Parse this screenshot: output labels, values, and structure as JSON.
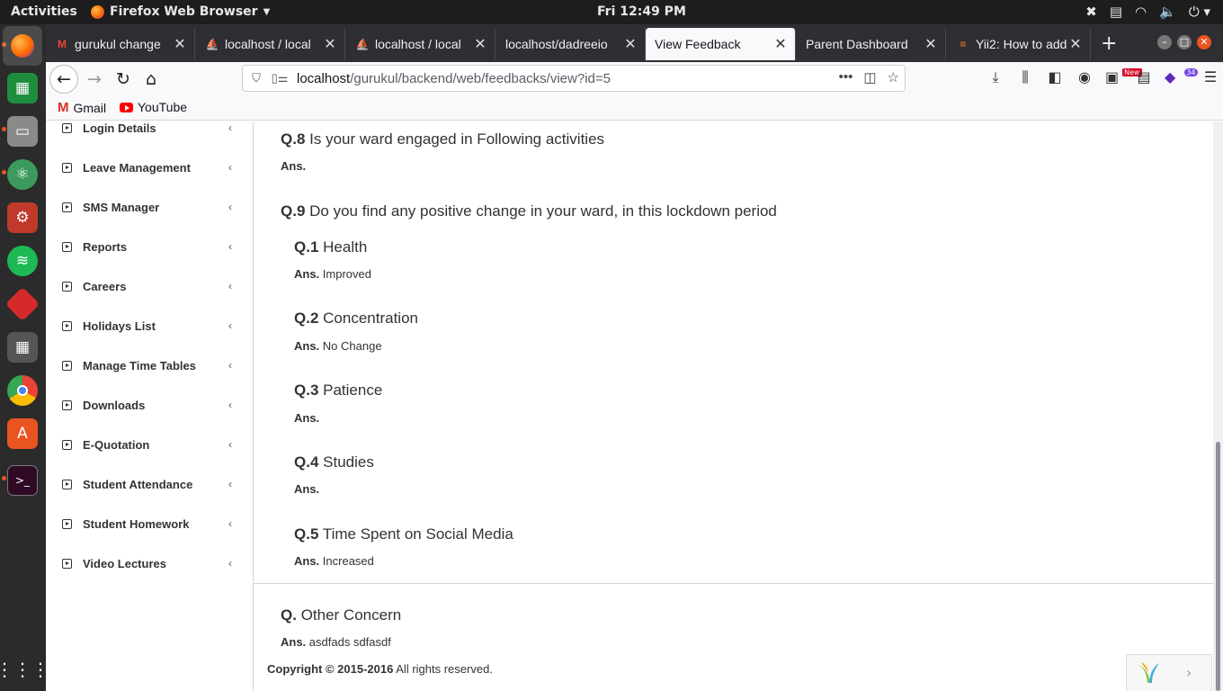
{
  "system": {
    "activities": "Activities",
    "app_name": "Firefox Web Browser",
    "clock": "Fri 12:49 PM"
  },
  "tabs": [
    {
      "label": "gurukul change",
      "icon": "gmail-icon",
      "active": false
    },
    {
      "label": "localhost / local",
      "icon": "phpmyadmin-icon",
      "active": false
    },
    {
      "label": "localhost / local",
      "icon": "phpmyadmin-icon",
      "active": false
    },
    {
      "label": "localhost/dadreeio",
      "icon": "",
      "active": false
    },
    {
      "label": "View Feedback",
      "icon": "",
      "active": true
    },
    {
      "label": "Parent Dashboard",
      "icon": "",
      "active": false
    },
    {
      "label": "Yii2: How to add",
      "icon": "stackoverflow-icon",
      "active": false
    }
  ],
  "address_bar": {
    "host": "localhost",
    "path": "/gurukul/backend/web/feedbacks/view?id=5"
  },
  "toolbar_badges": {
    "new": "New",
    "count": "34"
  },
  "bookmarks": [
    {
      "label": "Gmail",
      "icon": "gmail-icon"
    },
    {
      "label": "YouTube",
      "icon": "youtube-icon"
    }
  ],
  "sidebar": {
    "items": [
      {
        "label": "Login Details"
      },
      {
        "label": "Leave Management"
      },
      {
        "label": "SMS Manager"
      },
      {
        "label": "Reports"
      },
      {
        "label": "Careers"
      },
      {
        "label": "Holidays List"
      },
      {
        "label": "Manage Time Tables"
      },
      {
        "label": "Downloads"
      },
      {
        "label": "E-Quotation"
      },
      {
        "label": "Student Attendance"
      },
      {
        "label": "Student Homework"
      },
      {
        "label": "Video Lectures"
      }
    ]
  },
  "feedback": {
    "q8": {
      "num": "Q.8",
      "text": "Is your ward engaged in Following activities",
      "ans_label": "Ans.",
      "answer": ""
    },
    "q9": {
      "num": "Q.9",
      "text": "Do you find any positive change in your ward, in this lockdown period"
    },
    "subs": [
      {
        "num": "Q.1",
        "text": "Health",
        "ans_label": "Ans.",
        "answer": "Improved"
      },
      {
        "num": "Q.2",
        "text": "Concentration",
        "ans_label": "Ans.",
        "answer": "No Change"
      },
      {
        "num": "Q.3",
        "text": "Patience",
        "ans_label": "Ans.",
        "answer": ""
      },
      {
        "num": "Q.4",
        "text": "Studies",
        "ans_label": "Ans.",
        "answer": ""
      },
      {
        "num": "Q.5",
        "text": "Time Spent on Social Media",
        "ans_label": "Ans.",
        "answer": "Increased"
      }
    ],
    "other": {
      "num": "Q.",
      "text": "Other Concern",
      "ans_label": "Ans.",
      "answer": "asdfads sdfasdf"
    }
  },
  "footer": {
    "copyright_bold": "Copyright © 2015-2016",
    "rights": "All rights reserved."
  }
}
